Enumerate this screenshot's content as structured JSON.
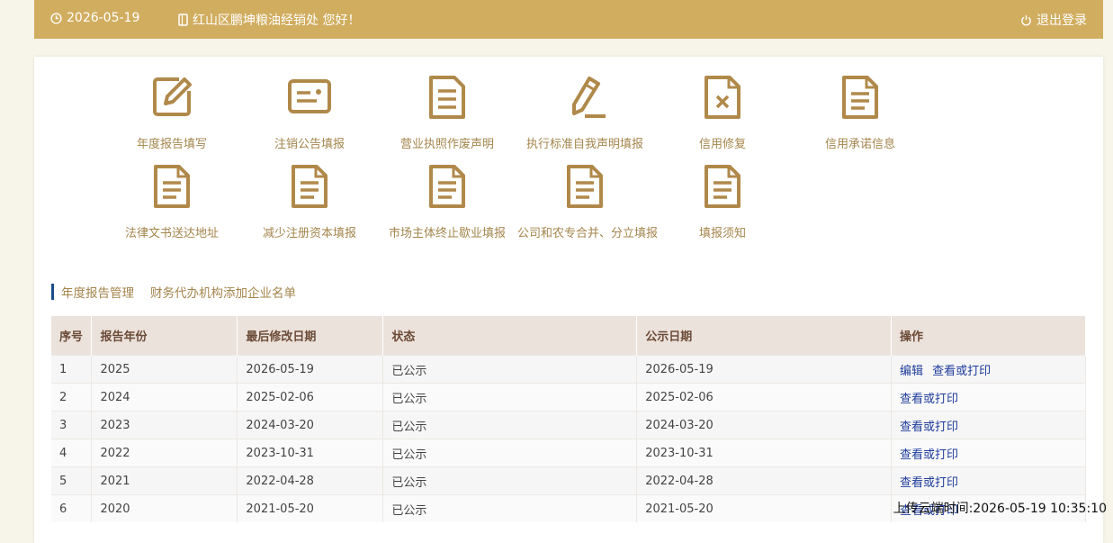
{
  "header": {
    "date": "2026-05-19",
    "greeting": "红山区鹏坤粮油经销处 您好！",
    "logout": "退出登录",
    "icons": [
      "clock-icon",
      "phone-icon",
      "power-icon"
    ],
    "colors": {
      "bar": "#d1ad5f"
    }
  },
  "actions": {
    "row1": [
      {
        "label": "年度报告填写",
        "icon": "edit-icon"
      },
      {
        "label": "注销公告填报",
        "icon": "id-card-icon"
      },
      {
        "label": "营业执照作废声明",
        "icon": "document-icon"
      },
      {
        "label": "执行标准自我声明填报",
        "icon": "pencil-icon"
      },
      {
        "label": "信用修复",
        "icon": "document-x-icon"
      },
      {
        "label": "信用承诺信息",
        "icon": "document-icon"
      }
    ],
    "row2": [
      {
        "label": "法律文书送达地址",
        "icon": "document-icon"
      },
      {
        "label": "减少注册资本填报",
        "icon": "document-icon"
      },
      {
        "label": "市场主体终止歇业填报",
        "icon": "document-icon"
      },
      {
        "label": "公司和农专合并、分立填报",
        "icon": "document-icon"
      },
      {
        "label": "填报须知",
        "icon": "document-icon"
      }
    ]
  },
  "tabs": [
    "年度报告管理",
    "财务代办机构添加企业名单"
  ],
  "table": {
    "headers": [
      "序号",
      "报告年份",
      "最后修改日期",
      "状态",
      "公示日期",
      "操作"
    ],
    "rows": [
      {
        "no": "1",
        "year": "2025",
        "modified": "2026-05-19",
        "status": "已公示",
        "published": "2026-05-19",
        "actions": [
          "编辑",
          "查看或打印"
        ]
      },
      {
        "no": "2",
        "year": "2024",
        "modified": "2025-02-06",
        "status": "已公示",
        "published": "2025-02-06",
        "actions": [
          "查看或打印"
        ]
      },
      {
        "no": "3",
        "year": "2023",
        "modified": "2024-03-20",
        "status": "已公示",
        "published": "2024-03-20",
        "actions": [
          "查看或打印"
        ]
      },
      {
        "no": "4",
        "year": "2022",
        "modified": "2023-10-31",
        "status": "已公示",
        "published": "2023-10-31",
        "actions": [
          "查看或打印"
        ]
      },
      {
        "no": "5",
        "year": "2021",
        "modified": "2022-04-28",
        "status": "已公示",
        "published": "2022-04-28",
        "actions": [
          "查看或打印"
        ]
      },
      {
        "no": "6",
        "year": "2020",
        "modified": "2021-05-20",
        "status": "已公示",
        "published": "2021-05-20",
        "actions": [
          "查看或打印"
        ]
      }
    ]
  },
  "upload_time": "上传云端时间:2026-05-19 10:35:10"
}
